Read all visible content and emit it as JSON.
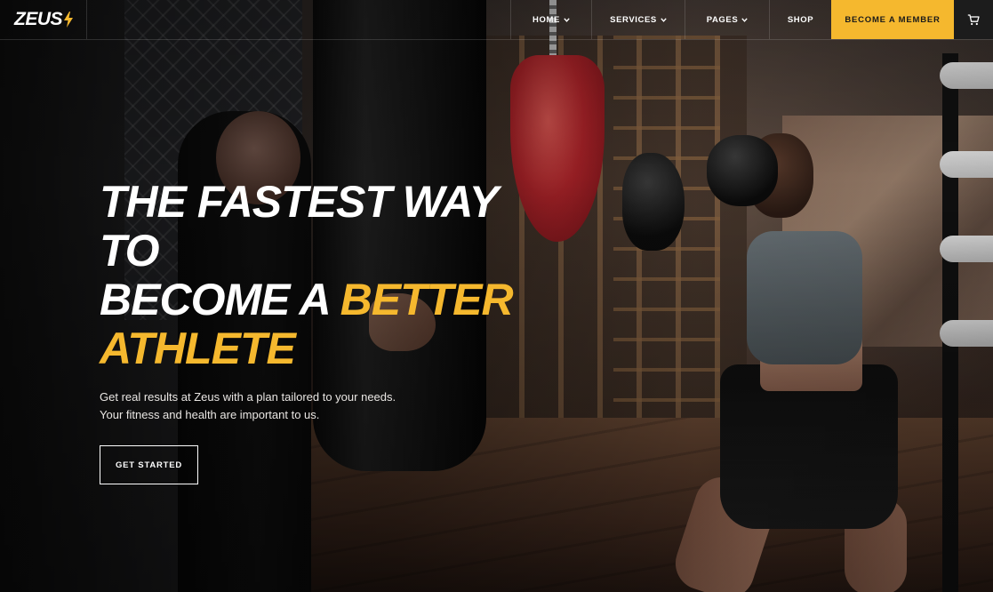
{
  "brand": {
    "name": "ZEUS",
    "accent_color": "#f5b82e"
  },
  "nav": {
    "home": "HOME",
    "services": "SERVICES",
    "pages": "PAGES",
    "shop": "SHOP",
    "cta": "BECOME A MEMBER",
    "cart_icon": "cart-icon",
    "caret_icon": "chevron-down-icon"
  },
  "hero": {
    "title_line1": "THE FASTEST WAY TO",
    "title_line2_prefix": "BECOME A ",
    "title_line2_accent": "BETTER",
    "title_line3_accent": "ATHLETE",
    "subtitle_line1": "Get real results at Zeus with a plan tailored to your needs.",
    "subtitle_line2": "Your fitness and health are important to us.",
    "button": "GET STARTED"
  },
  "colors": {
    "accent": "#f5b82e",
    "header_border": "rgba(255,255,255,0.14)",
    "cart_bg": "#1c1c1c"
  }
}
